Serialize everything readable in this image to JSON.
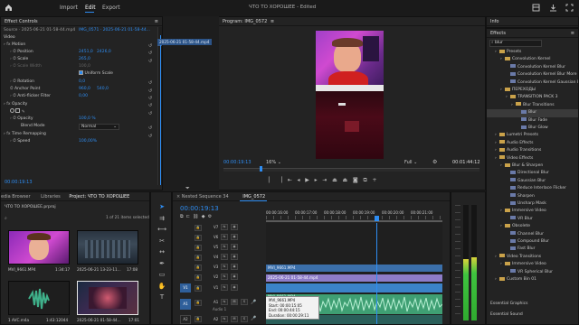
{
  "menu": {
    "home_icon": "home-icon",
    "items": [
      "Import",
      "Edit",
      "Export"
    ],
    "active": "Edit",
    "title": "ЧТО ТО ХОРОШЕЕ - Edited"
  },
  "effect_controls": {
    "tab": "Effect Controls",
    "source": "Source · 2025-06-21 01-58-44.mp4",
    "clip": "IMG_0571 · 2025-06-21 01-58-44...",
    "timeline_clip": "2025-06-21 01-58-44.mp4",
    "section": "Video",
    "motion": "Motion",
    "position_label": "Position",
    "position_x": "2451,0",
    "position_y": "2426,0",
    "scale_label": "Scale",
    "scale_val": "265,0",
    "scale_width_label": "Scale Width",
    "scale_width_val": "100,0",
    "uniform_label": "Uniform Scale",
    "rotation_label": "Rotation",
    "rotation_val": "0,0",
    "anchor_label": "Anchor Point",
    "anchor_x": "960,0",
    "anchor_y": "540,0",
    "antiflicker_label": "Anti-flicker Filter",
    "antiflicker_val": "0,00",
    "opacity": "Opacity",
    "opacity_label": "Opacity",
    "opacity_val": "100,0 %",
    "blend_label": "Blend Mode",
    "blend_val": "Normal",
    "time_remap": "Time Remapping",
    "speed_label": "Speed",
    "speed_val": "100,00%",
    "timecode": "00:00:19:13"
  },
  "program": {
    "tab": "Program: IMG_0572",
    "timecode": "00:00:19:13",
    "zoom": "16%",
    "quality": "Full",
    "duration": "00:01:44:12"
  },
  "info_panel": {
    "tab": "Info"
  },
  "effects_panel": {
    "tab": "Effects",
    "search": "blur",
    "items": [
      {
        "level": 1,
        "kind": "folder",
        "label": "Presets"
      },
      {
        "level": 2,
        "kind": "folder",
        "label": "Convolution Kernel"
      },
      {
        "level": 3,
        "kind": "fx",
        "label": "Convolution Kernel Blur"
      },
      {
        "level": 3,
        "kind": "fx",
        "label": "Convolution Kernel Blur More"
      },
      {
        "level": 3,
        "kind": "fx",
        "label": "Convolution Kernel Gaussian Blur"
      },
      {
        "level": 2,
        "kind": "folder",
        "label": "ПЕРЕХОДЫ"
      },
      {
        "level": 3,
        "kind": "folder",
        "label": "TRANSITION PACK 3"
      },
      {
        "level": 4,
        "kind": "folder",
        "label": "Blur Transitions"
      },
      {
        "level": 5,
        "kind": "fx",
        "label": "Blur",
        "selected": true
      },
      {
        "level": 5,
        "kind": "fx",
        "label": "Blur Fade"
      },
      {
        "level": 5,
        "kind": "fx",
        "label": "Blur Glow"
      },
      {
        "level": 1,
        "kind": "folder",
        "label": "Lumetri Presets"
      },
      {
        "level": 1,
        "kind": "folder",
        "label": "Audio Effects"
      },
      {
        "level": 1,
        "kind": "folder",
        "label": "Audio Transitions"
      },
      {
        "level": 1,
        "kind": "folder",
        "label": "Video Effects"
      },
      {
        "level": 2,
        "kind": "folder",
        "label": "Blur & Sharpen"
      },
      {
        "level": 3,
        "kind": "fx",
        "label": "Directional Blur"
      },
      {
        "level": 3,
        "kind": "fx",
        "label": "Gaussian Blur"
      },
      {
        "level": 3,
        "kind": "fx",
        "label": "Reduce Interlace Flicker"
      },
      {
        "level": 3,
        "kind": "fx",
        "label": "Sharpen"
      },
      {
        "level": 3,
        "kind": "fx",
        "label": "Unsharp Mask"
      },
      {
        "level": 2,
        "kind": "folder",
        "label": "Immersive Video"
      },
      {
        "level": 3,
        "kind": "fx",
        "label": "VR Blur"
      },
      {
        "level": 2,
        "kind": "folder",
        "label": "Obsolete"
      },
      {
        "level": 3,
        "kind": "fx",
        "label": "Channel Blur"
      },
      {
        "level": 3,
        "kind": "fx",
        "label": "Compound Blur"
      },
      {
        "level": 3,
        "kind": "fx",
        "label": "Fast Blur"
      },
      {
        "level": 1,
        "kind": "folder",
        "label": "Video Transitions"
      },
      {
        "level": 2,
        "kind": "folder",
        "label": "Immersive Video"
      },
      {
        "level": 3,
        "kind": "fx",
        "label": "VR Spherical Blur"
      },
      {
        "level": 1,
        "kind": "folder",
        "label": "Custom Bin 01"
      }
    ],
    "bottom": [
      "Essential Graphics",
      "Essential Sound"
    ]
  },
  "project": {
    "tabs": [
      "edia Browser",
      "Libraries",
      "Project: ЧТО ТО ХОРОШЕЕ"
    ],
    "file": "ЧТО ТО ХОРОШЕЕ.prproj",
    "count": "1 of 21 items selected",
    "items": [
      {
        "name": "MVI_9661.MP4",
        "dur": "1:34:17"
      },
      {
        "name": "2025-06-21 13-23-11...",
        "dur": "17:08"
      },
      {
        "name": "1 AVC.m4a",
        "dur": "1:43:12044"
      },
      {
        "name": "2025-06-21 01-58-44...",
        "dur": "17:01"
      }
    ]
  },
  "timeline": {
    "tabs": [
      "Nested Sequence 34",
      "IMG_0572"
    ],
    "timecode": "00:00:19:13",
    "ruler": [
      "00:00:16:00",
      "00:00:17:00",
      "00:00:18:00",
      "00:00:19:00",
      "00:00:20:00",
      "00:00:21:00"
    ],
    "tracks": [
      "V7",
      "V6",
      "V5",
      "V4",
      "V3",
      "V2",
      "V1",
      "A1",
      "A2"
    ],
    "clip_v3": "MVI_9661.MP4",
    "clip_v2": "2025-06-21 01-58-44.mp4",
    "clip_a1": "MVI_9661.MP4",
    "audio_label": "Audio 1",
    "tooltip": [
      "MVI_9661.MP4",
      "Start: 00:00:15:05",
      "End: 00:00:44:15",
      "Duration: 00:00:29:11"
    ]
  },
  "colors": {
    "accent": "#2e8df2",
    "clip_purple": "#8d7cc8",
    "clip_blue": "#3b83c8",
    "clip_green": "#3f9f73",
    "panel": "#232323"
  }
}
